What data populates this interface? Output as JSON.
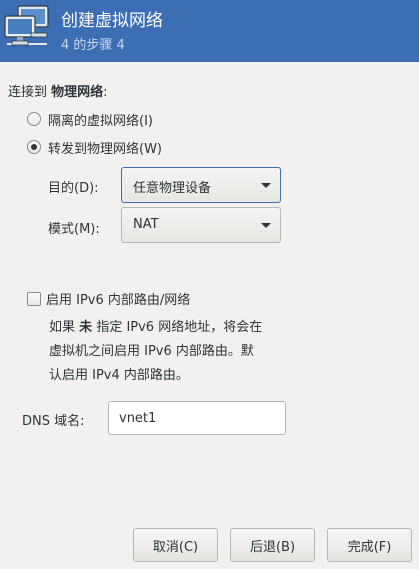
{
  "header": {
    "title": "创建虚拟网络",
    "subtitle": "4 的步骤 4"
  },
  "connect": {
    "prefix": "连接到",
    "emphasis": "物理网络",
    "suffix": ":"
  },
  "radios": [
    {
      "label": "隔离的虚拟网络(I)",
      "checked": false
    },
    {
      "label": "转发到物理网络(W)",
      "checked": true
    }
  ],
  "destination": {
    "label": "目的(D):",
    "value": "任意物理设备"
  },
  "mode": {
    "label": "模式(M):",
    "value": "NAT"
  },
  "ipv6": {
    "checkbox_label": "启用 IPv6 内部路由/网络",
    "checked": false,
    "note_line1_pre": "如果",
    "note_line1_bold": "未",
    "note_line1_post": "指定 IPv6 网络地址，将会在",
    "note_line2": "虚拟机之间启用 IPv6 内部路由。默",
    "note_line3": "认启用 IPv4 内部路由。"
  },
  "dns": {
    "label": "DNS 域名:",
    "value": "vnet1"
  },
  "buttons": {
    "cancel": "取消(C)",
    "back": "后退(B)",
    "finish": "完成(F)"
  },
  "colors": {
    "header_bg": "#3c6eb4",
    "window_bg": "#f2f1f0"
  }
}
